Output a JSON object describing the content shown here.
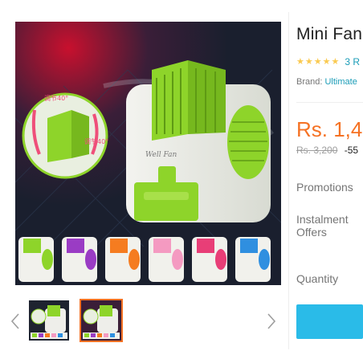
{
  "product": {
    "title": "Mini Fan",
    "rating_count": "3 R",
    "brand_label": "Brand:",
    "brand_value": "Ultimate",
    "price": "Rs. 1,4",
    "old_price": "Rs. 3,200",
    "discount": "-55",
    "stars": 5
  },
  "details": {
    "promotions_label": "Promotions",
    "instalment_label": "Instalment Offers",
    "quantity_label": "Quantity"
  },
  "image_overlay": {
    "left_arrow_text": "调节40°",
    "right_arrow_text": "调节40°",
    "logo_text": "Well Fan"
  },
  "gallery": {
    "thumbnails": 2,
    "selected_thumbnail": 2
  },
  "colors": {
    "accent_orange": "#f57224",
    "link_blue": "#1a9cb7",
    "button_blue": "#2abbe8",
    "star_yellow": "#faca51",
    "fan_green": "#8ed42a"
  },
  "icons": {
    "prev": "chevron-left-icon",
    "next": "chevron-right-icon",
    "star": "star-icon"
  }
}
